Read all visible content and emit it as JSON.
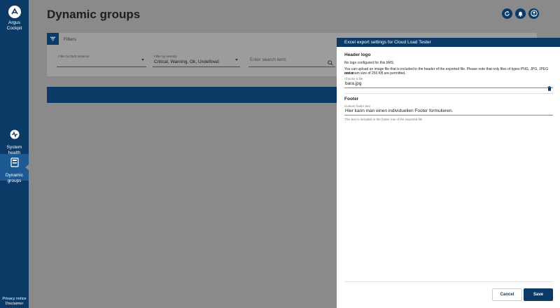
{
  "sidebar": {
    "logo_text_1": "Argus",
    "logo_text_2": "Cockpit",
    "items": [
      {
        "label_1": "System",
        "label_2": "health",
        "icon": "system-health-icon"
      },
      {
        "label_1": "Dynamic",
        "label_2": "groups",
        "icon": "dynamic-groups-icon",
        "active": true
      }
    ],
    "footer_1": "Privacy notice",
    "footer_2": "Disclaimer"
  },
  "page": {
    "title": "Dynamic groups",
    "actions": [
      "refresh-icon",
      "bell-icon",
      "account-icon"
    ]
  },
  "filters": {
    "title": "Filters",
    "bms_label": "Filter by bMS instance",
    "bms_value": "",
    "severity_label": "Filter by severity",
    "severity_value": "Critical, Warning, Ok, Undefined",
    "search_placeholder": "Enter search term"
  },
  "dialog": {
    "title": "Excel export settings for Cloud Load Tester",
    "header_logo": {
      "title": "Header logo",
      "status": "No logo configured for this bMS.",
      "description_1": "You can upload an image file that is included in the header of the exported file. Please note that only files of types PNG, JPG, JPEG and a",
      "description_2": "maximum size of 250 KB are permitted.",
      "file_label": "Choose a file",
      "file_value": "bara.jpg"
    },
    "footer": {
      "title": "Footer",
      "field_label": "Custom footer text",
      "field_value": "Hier kann man einen individuellen Footer formulieren.",
      "hint": "This text is included in the footer row of the exported file"
    },
    "cancel_label": "Cancel",
    "save_label": "Save"
  },
  "colors": {
    "brand": "#0b3a66",
    "overlay": "#8a8a8a"
  }
}
